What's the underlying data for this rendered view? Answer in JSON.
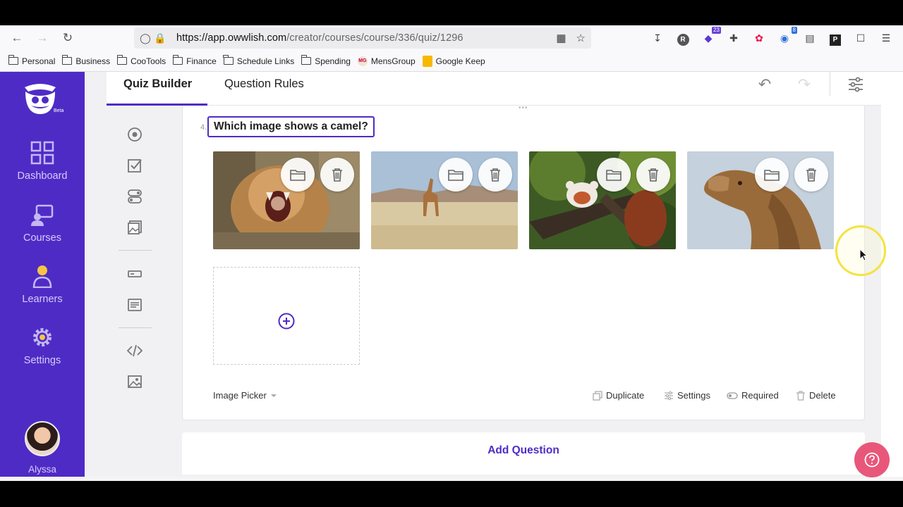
{
  "browser": {
    "url_domain": "https://app.owwlish.com",
    "url_path": "/creator/courses/course/336/quiz/1296",
    "ext_badges": [
      "R",
      "23",
      "8",
      "P"
    ],
    "bookmarks": [
      "Personal",
      "Business",
      "CooTools",
      "Finance",
      "Schedule Links",
      "Spending",
      "MensGroup",
      "Google Keep"
    ]
  },
  "sidebar": {
    "logo_badge": "Beta",
    "items": [
      {
        "label": "Dashboard",
        "icon": "dashboard-icon"
      },
      {
        "label": "Courses",
        "icon": "courses-icon"
      },
      {
        "label": "Learners",
        "icon": "learners-icon"
      },
      {
        "label": "Settings",
        "icon": "settings-icon"
      }
    ],
    "user_name": "Alyssa"
  },
  "tabs": [
    {
      "label": "Quiz Builder",
      "active": true
    },
    {
      "label": "Question Rules",
      "active": false
    }
  ],
  "question": {
    "number": "4.",
    "title": "Which image shows a camel?",
    "images": [
      {
        "subject": "lion"
      },
      {
        "subject": "giraffe"
      },
      {
        "subject": "red panda"
      },
      {
        "subject": "camel"
      }
    ],
    "type_label": "Image Picker",
    "footer": {
      "duplicate": "Duplicate",
      "settings": "Settings",
      "required": "Required",
      "delete": "Delete"
    }
  },
  "add_question_label": "Add Question",
  "colors": {
    "brand": "#4f2bc6",
    "help": "#e8577a"
  }
}
